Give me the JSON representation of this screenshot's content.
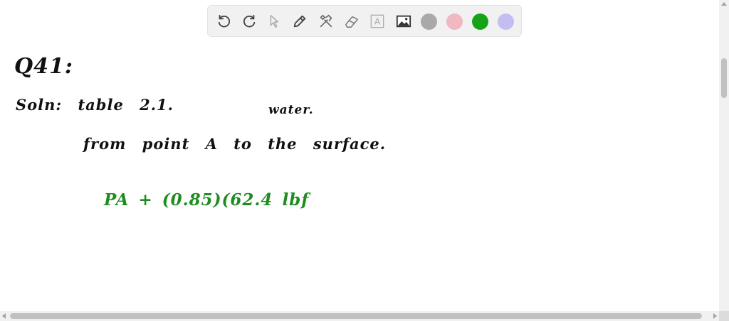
{
  "toolbar": {
    "tools": [
      {
        "icon": "undo-icon"
      },
      {
        "icon": "redo-icon"
      },
      {
        "icon": "pointer-icon"
      },
      {
        "icon": "pen-icon"
      },
      {
        "icon": "tools-icon"
      },
      {
        "icon": "eraser-icon"
      },
      {
        "icon": "text-icon",
        "glyph": "A"
      },
      {
        "icon": "image-icon"
      }
    ],
    "colors": [
      "#a9a9ab",
      "#f0b8c0",
      "#17a317",
      "#c2bff0"
    ]
  },
  "notes": {
    "line1": "Q41:",
    "line2": "Soln: table 2.1.",
    "line3": "water.",
    "line4": "from point A to the surface.",
    "line5": "PA + (0.85)(62.4 lbf"
  }
}
